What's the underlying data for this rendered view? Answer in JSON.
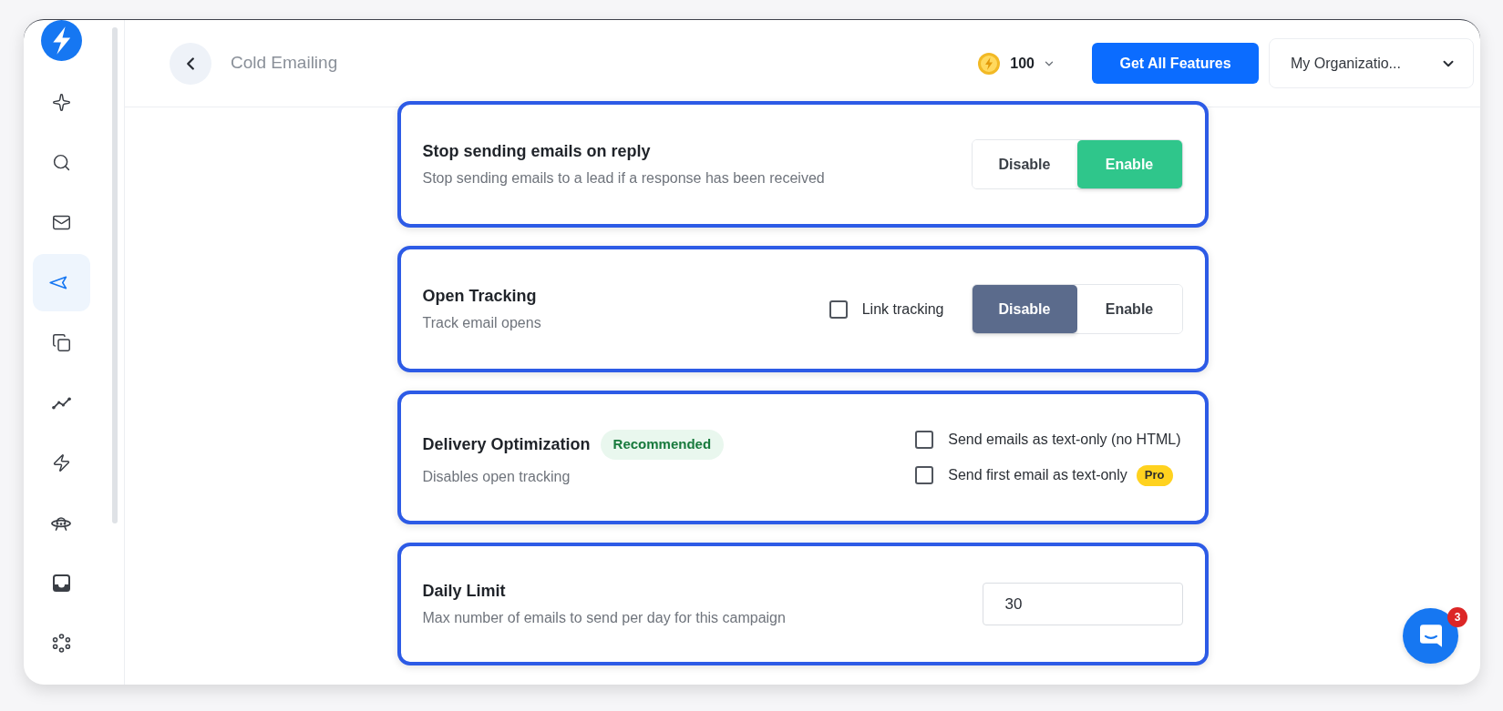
{
  "sidebar": {
    "items": [
      {
        "selected": false
      },
      {
        "selected": false
      },
      {
        "selected": false
      },
      {
        "selected": true
      },
      {
        "selected": false
      },
      {
        "selected": false
      },
      {
        "selected": false
      },
      {
        "selected": false
      },
      {
        "selected": false
      },
      {
        "selected": false
      }
    ]
  },
  "header": {
    "title": "Cold Emailing",
    "credits": "100",
    "upgrade_button": "Get All Features",
    "organization": "My Organizatio..."
  },
  "settings": [
    {
      "kind": "toggle",
      "title": "Stop sending emails on reply",
      "description": "Stop sending emails to a lead if a response has been received",
      "options": [
        {
          "label": "Disable",
          "selected": false
        },
        {
          "label": "Enable",
          "selected": true
        }
      ]
    },
    {
      "kind": "toggle",
      "title": "Open Tracking",
      "description": "Track email opens",
      "checkboxes": [
        {
          "label": "Link tracking",
          "checked": false
        }
      ],
      "options": [
        {
          "label": "Disable",
          "selected": true
        },
        {
          "label": "Enable",
          "selected": false
        }
      ]
    },
    {
      "kind": "checklist",
      "title": "Delivery Optimization",
      "badge": "Recommended",
      "description": "Disables open tracking",
      "checkboxes": [
        {
          "label": "Send emails as text-only (no HTML)",
          "checked": false
        },
        {
          "label": "Send first email as text-only",
          "checked": false,
          "badge": "Pro"
        }
      ]
    },
    {
      "kind": "number",
      "title": "Daily Limit",
      "description": "Max number of emails to send per day for this campaign",
      "value": "30"
    }
  ],
  "chat": {
    "unread": "3"
  }
}
